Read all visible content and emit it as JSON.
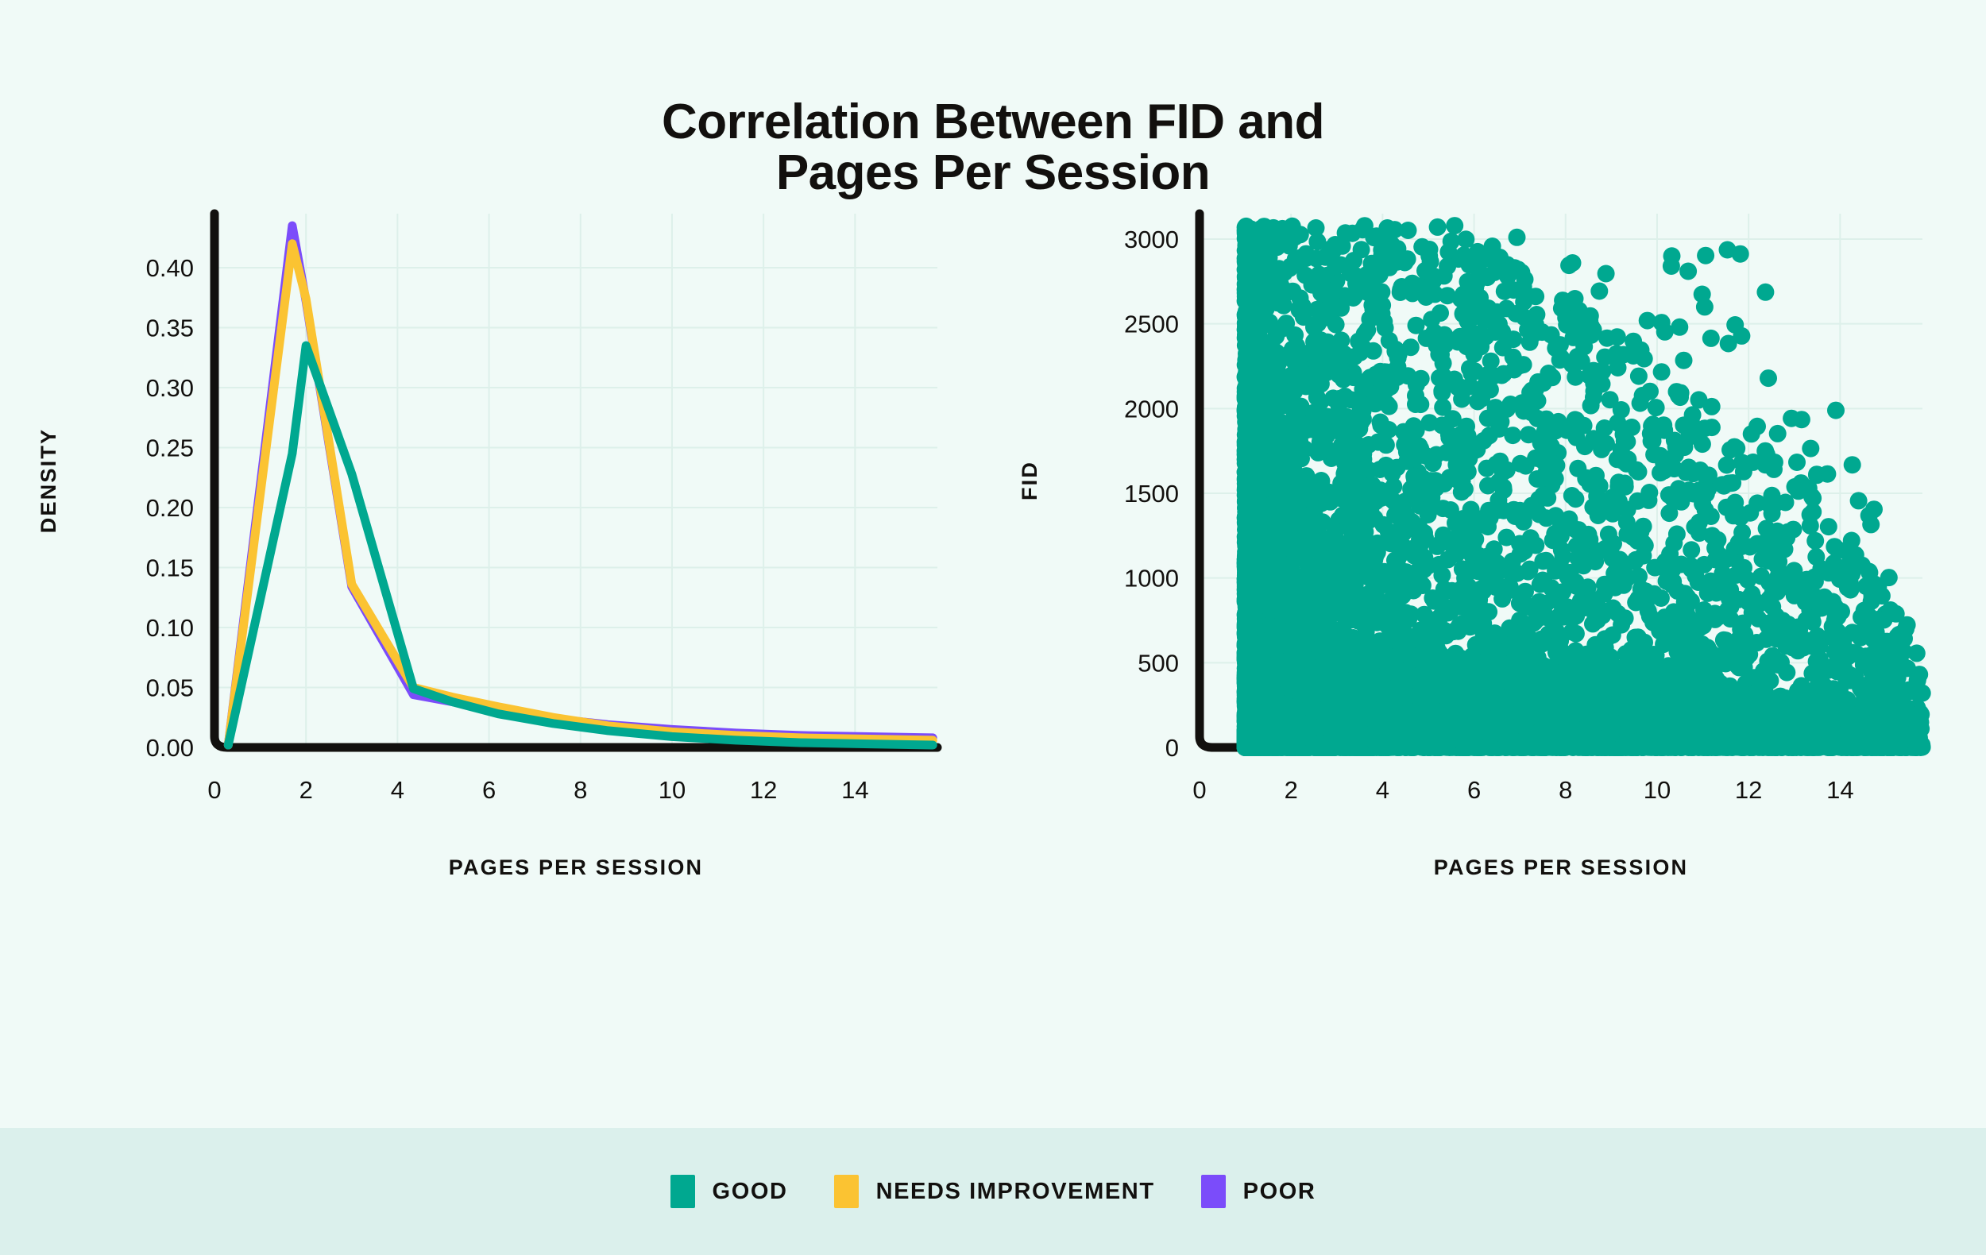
{
  "title": "Correlation Between FID and\nPages Per Session",
  "title_line1": "Correlation Between FID and",
  "title_line2": "Pages Per Session",
  "colors": {
    "background": "#F0FAF7",
    "legend_band": "#DBF0EC",
    "good": "#00A890",
    "needs_improvement": "#FBC332",
    "poor": "#7B4CFA",
    "axis": "#12100E",
    "grid": "#DDF0EA",
    "text": "#12100E"
  },
  "legend": {
    "position": "bottom",
    "items": [
      {
        "label": "GOOD",
        "color": "#00A890"
      },
      {
        "label": "NEEDS IMPROVEMENT",
        "color": "#FBC332"
      },
      {
        "label": "POOR",
        "color": "#7B4CFA"
      }
    ]
  },
  "chart_data": [
    {
      "type": "line",
      "id": "density-distribution",
      "title": "",
      "xlabel": "PAGES PER SESSION",
      "ylabel": "DENSITY",
      "xlim": [
        0,
        15.8
      ],
      "ylim": [
        0,
        0.445
      ],
      "xticks": [
        0,
        2,
        4,
        6,
        8,
        10,
        12,
        14
      ],
      "xticklabels": [
        "0",
        "2",
        "4",
        "6",
        "8",
        "10",
        "12",
        "14"
      ],
      "yticks": [
        0.0,
        0.05,
        0.1,
        0.15,
        0.2,
        0.25,
        0.3,
        0.35,
        0.4
      ],
      "yticklabels": [
        "0.00",
        "0.05",
        "0.10",
        "0.15",
        "0.20",
        "0.25",
        "0.30",
        "0.35",
        "0.40"
      ],
      "grid": true,
      "x": [
        0.3,
        1.7,
        2.0,
        3.0,
        4.35,
        5.2,
        6.2,
        7.4,
        8.6,
        10.0,
        11.4,
        12.8,
        14.2,
        15.7
      ],
      "series": [
        {
          "name": "GOOD",
          "color": "#00A890",
          "values": [
            0.002,
            0.245,
            0.335,
            0.228,
            0.049,
            0.038,
            0.028,
            0.02,
            0.014,
            0.009,
            0.006,
            0.004,
            0.003,
            0.002
          ]
        },
        {
          "name": "NEEDS IMPROVEMENT",
          "color": "#FBC332",
          "values": [
            0.002,
            0.42,
            0.374,
            0.136,
            0.05,
            0.042,
            0.034,
            0.025,
            0.018,
            0.013,
            0.01,
            0.008,
            0.007,
            0.006
          ]
        },
        {
          "name": "POOR",
          "color": "#7B4CFA",
          "values": [
            0.002,
            0.435,
            0.372,
            0.134,
            0.044,
            0.038,
            0.031,
            0.024,
            0.019,
            0.015,
            0.012,
            0.01,
            0.009,
            0.008
          ]
        }
      ]
    },
    {
      "type": "scatter",
      "id": "fid-vs-pages",
      "title": "",
      "xlabel": "PAGES PER SESSION",
      "ylabel": "FID",
      "xlim": [
        0,
        15.8
      ],
      "ylim": [
        0,
        3150
      ],
      "xticks": [
        0,
        2,
        4,
        6,
        8,
        10,
        12,
        14
      ],
      "xticklabels": [
        "0",
        "2",
        "4",
        "6",
        "8",
        "10",
        "12",
        "14"
      ],
      "yticks": [
        0,
        500,
        1000,
        1500,
        2000,
        2500,
        3000
      ],
      "yticklabels": [
        "0",
        "500",
        "1000",
        "1500",
        "2000",
        "2500",
        "3000"
      ],
      "grid": true,
      "series_name": "GOOD",
      "color": "#00A890",
      "marker_size": 11,
      "n_points": 6000,
      "x_min_data": 1.0,
      "x_max_data": 15.8,
      "description": "Dense left-edge column near x=1 spanning FID 0-3050; density decays rightward and upward, envelope of FID upper bound falls from ~3000 at x=1 to ~500 at x=15; solid saturated mass below the decaying envelope."
    }
  ]
}
